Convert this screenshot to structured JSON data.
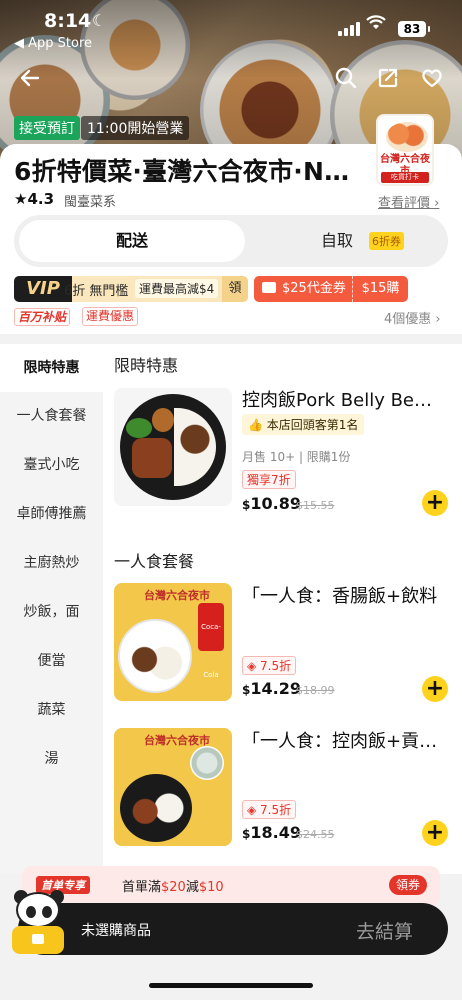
{
  "status_bar": {
    "time": "8:14",
    "back_app": "◀ App Store",
    "battery": "83"
  },
  "header": {
    "tag_preorder": "接受預訂",
    "tag_open": "11:00開始營業"
  },
  "store": {
    "title": "6折特價菜·臺灣六合夜市·N…",
    "rating": "4.3",
    "cuisine": "閩臺菜系",
    "reviews_link": "查看評價 ›",
    "logo_text": "台灣六合夜市",
    "logo_sub": "吃貨打卡"
  },
  "mode_toggle": {
    "delivery": "配送",
    "pickup": "自取",
    "pickup_badge": "6折券"
  },
  "promos": {
    "vip_label": "VIP",
    "vip_discount": "6折 無門檻",
    "vip_cap": "運費最高減$4",
    "vip_claim": "領",
    "coupon": "$25代金券",
    "coupon_buy": "$15購",
    "subsidy": "百万补贴",
    "shipping_offer": "運費優惠",
    "offers_count": "4個優惠 ›"
  },
  "sidebar": {
    "items": [
      {
        "label": "限時特惠",
        "active": true
      },
      {
        "label": "一人食套餐"
      },
      {
        "label": "臺式小吃"
      },
      {
        "label": "卓師傅推薦"
      },
      {
        "label": "主廚熱炒"
      },
      {
        "label": "炒飯，面"
      },
      {
        "label": "便當"
      },
      {
        "label": "蔬菜"
      },
      {
        "label": "湯"
      }
    ]
  },
  "sections": [
    {
      "title": "限時特惠",
      "dishes": [
        {
          "name": "控肉飯Pork Belly Be…",
          "rank": "本店回頭客第1名",
          "sold": "月售 10+ | 限購1份",
          "discount": "獨享7折",
          "price_symbol": "$",
          "price": "10.89",
          "original_price": "$15.55"
        }
      ]
    },
    {
      "title": "一人食套餐",
      "dishes": [
        {
          "name": "「一人食：香腸飯+飲料",
          "discount": "7.5折",
          "price_symbol": "$",
          "price": "14.29",
          "original_price": "$18.99",
          "image_title": "台灣六合夜市",
          "drink_label": "Coca-Cola"
        },
        {
          "name": "「一人食：控肉飯+貢…",
          "discount": "7.5折",
          "price_symbol": "$",
          "price": "18.49",
          "original_price": "$24.55",
          "image_title": "台灣六合夜市"
        }
      ]
    }
  ],
  "bottom": {
    "promo_badge": "首单专享",
    "promo_prefix": "首單滿",
    "promo_threshold": "$20",
    "promo_middle": "減",
    "promo_off": "$10",
    "promo_claim": "領券",
    "cart_text": "未選購商品",
    "checkout": "去結算"
  },
  "colors": {
    "accent_yellow": "#ffd21e",
    "promo_red": "#e4352b",
    "open_green": "#1aa55a"
  }
}
